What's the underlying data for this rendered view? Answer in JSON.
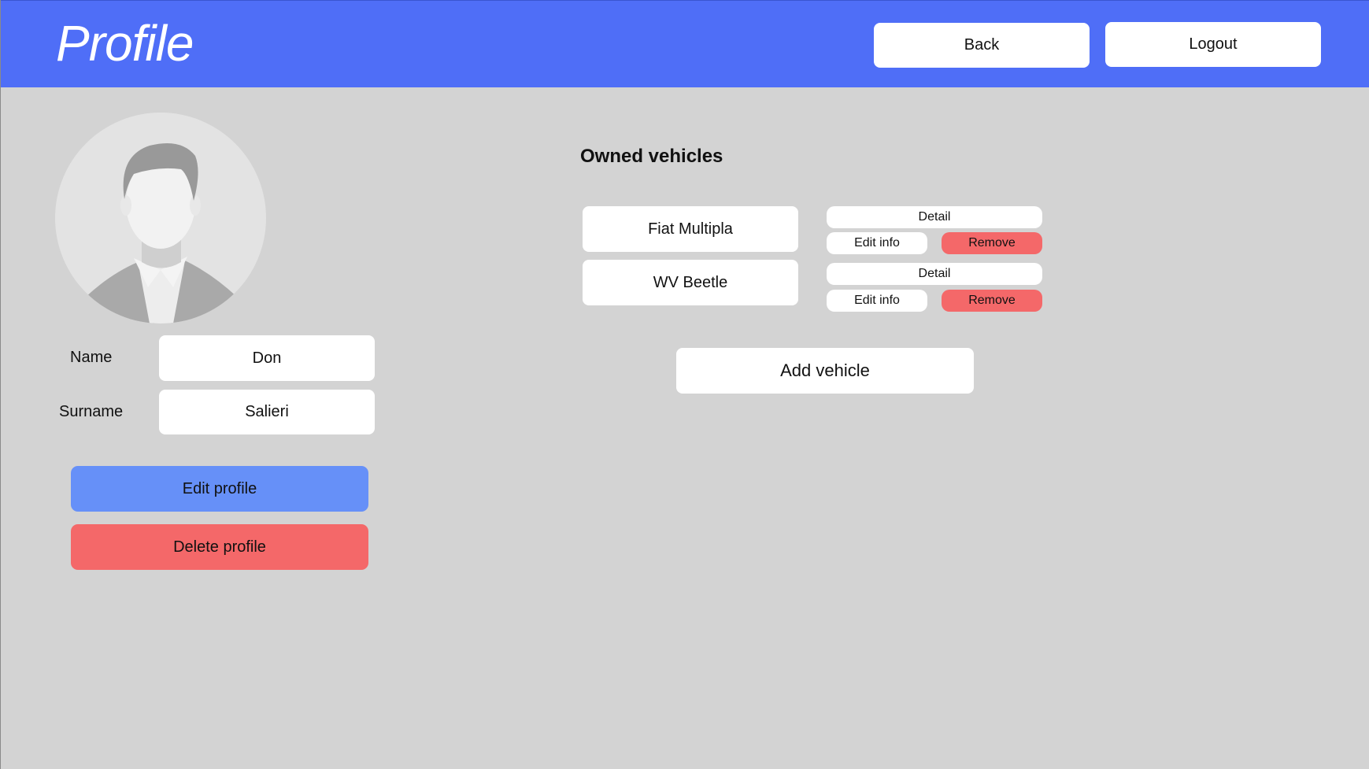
{
  "header": {
    "title": "Profile",
    "back_label": "Back",
    "logout_label": "Logout"
  },
  "profile": {
    "name_label": "Name",
    "name_value": "Don",
    "surname_label": "Surname",
    "surname_value": "Salieri",
    "edit_label": "Edit profile",
    "delete_label": "Delete profile"
  },
  "vehicles": {
    "title": "Owned vehicles",
    "items": [
      {
        "name": "Fiat Multipla",
        "detail_label": "Detail",
        "edit_label": "Edit info",
        "remove_label": "Remove"
      },
      {
        "name": "WV Beetle",
        "detail_label": "Detail",
        "edit_label": "Edit info",
        "remove_label": "Remove"
      }
    ],
    "add_label": "Add vehicle"
  },
  "colors": {
    "header": "#4f6ef7",
    "background": "#d3d3d3",
    "edit": "#6690f8",
    "danger": "#f46869"
  }
}
